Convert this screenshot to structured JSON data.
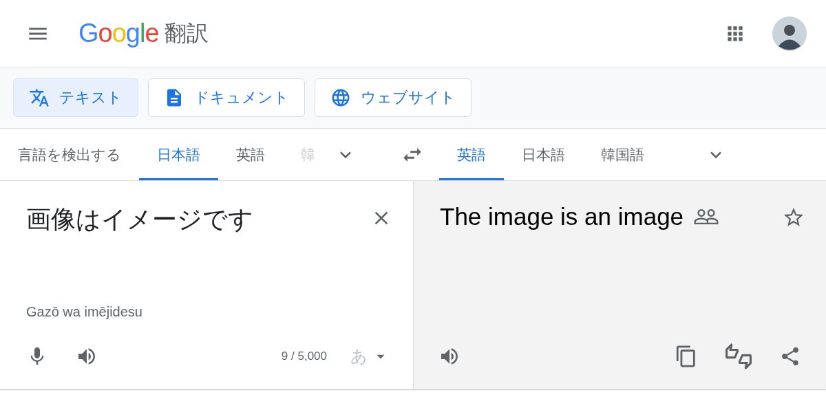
{
  "header": {
    "logo": "Google",
    "title": "翻訳"
  },
  "modes": [
    {
      "label": "テキスト",
      "kind": "text",
      "selected": true
    },
    {
      "label": "ドキュメント",
      "kind": "document",
      "selected": false
    },
    {
      "label": "ウェブサイト",
      "kind": "website",
      "selected": false
    }
  ],
  "source_languages": [
    {
      "label": "言語を検出する",
      "selected": false,
      "faded": false
    },
    {
      "label": "日本語",
      "selected": true,
      "faded": false
    },
    {
      "label": "英語",
      "selected": false,
      "faded": false
    },
    {
      "label": "韓",
      "selected": false,
      "faded": true
    }
  ],
  "target_languages": [
    {
      "label": "英語",
      "selected": true
    },
    {
      "label": "日本語",
      "selected": false
    },
    {
      "label": "韓国語",
      "selected": false
    }
  ],
  "source": {
    "text": "画像はイメージです",
    "romanization": "Gazō wa imējidesu",
    "counter": "9 / 5,000",
    "input_method": "あ",
    "input_method_disabled": true
  },
  "target": {
    "text": "The image is an image"
  }
}
